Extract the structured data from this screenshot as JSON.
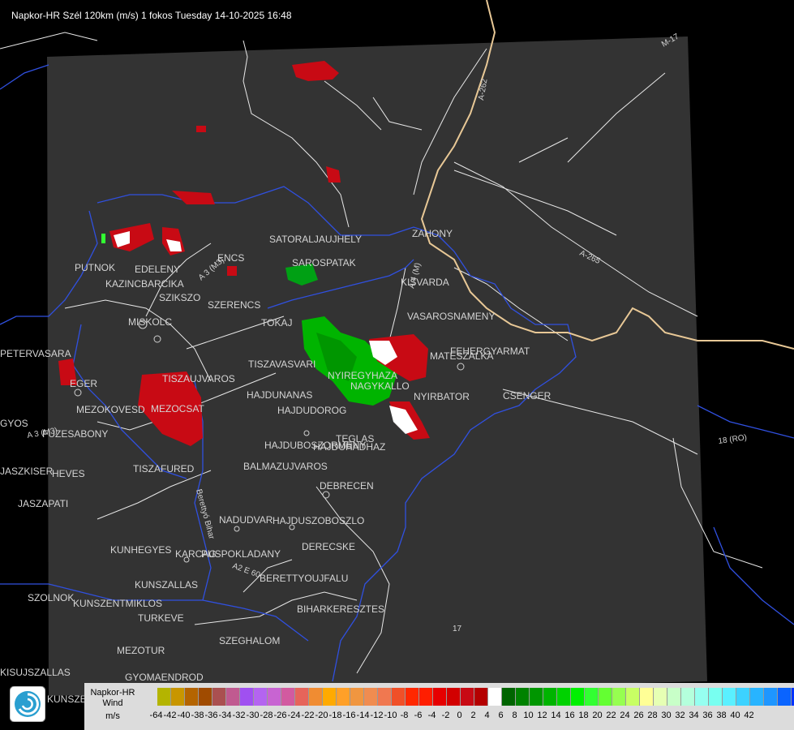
{
  "header": {
    "title": "Napkor-HR Szél 120km (m/s) 1 fokos Tuesday 14-10-2025 16:48"
  },
  "map": {
    "places": [
      "SATORALJAUJHELY",
      "ZAHONY",
      "SAROSPATAK",
      "KISVARDA",
      "PUTNOK",
      "EDELENY",
      "KAZINCBARCIKA",
      "SZIKSZO",
      "ENCS",
      "SZERENCS",
      "TOKAJ",
      "VASAROSNAMENY",
      "MISKOLC",
      "FEHERGYARMAT",
      "MATESZALKA",
      "TISZAVASVARI",
      "PETERVASARA",
      "EGER",
      "TISZAUJVAROS",
      "NYIREGYHAZA",
      "NAGYKALLO",
      "NYIRBATOR",
      "CSENGER",
      "HAJDUNANAS",
      "MEZOKOVESD",
      "MEZOCSAT",
      "HAJDUDOROG",
      "GYOS",
      "FUZESABONY",
      "TEGLAS",
      "HAJDUBOSZORMENY",
      "HAJDUHADHAZ",
      "HEVES",
      "TISZAFURED",
      "BALMAZUJVAROS",
      "DEBRECEN",
      "JASZAPATI",
      "NADUDVAR",
      "HAJDUSZOBOSZLO",
      "KUNHEGYES",
      "KARCAG",
      "PUSPOKLADANY",
      "DERECSKE",
      "KUNSZALLAS",
      "BERETTYOUJFALU",
      "SZOLNOK",
      "KUNSZENTMIKLOS",
      "TURKEVE",
      "BIHARKERESZTES",
      "SZEGHALOM",
      "MEZOTUR",
      "GYOMAENDROD",
      "JASZKISER",
      "KISUJSZALLAS",
      "KUNSZENTMARTON"
    ],
    "roads": [
      "M-17",
      "A-262",
      "A-265",
      "A 3 (M3)",
      "A 4 (M)",
      "18 (RO)",
      "A 3 (M3)",
      "17",
      "A2 E 60",
      "Berettyó Bihar"
    ]
  },
  "legend": {
    "title_line1": "Napkor-HR",
    "title_line2": "Wind",
    "unit": "m/s",
    "colors": [
      "#b4b400",
      "#c89600",
      "#b46400",
      "#a04b00",
      "#aa5050",
      "#c05a90",
      "#a050f0",
      "#b464f0",
      "#c864d2",
      "#d25aa0",
      "#e6645a",
      "#f08c32",
      "#ffaa00",
      "#ffa028",
      "#f09640",
      "#f08c50",
      "#f07850",
      "#f05028",
      "#ff2800",
      "#ff1e00",
      "#e60000",
      "#d20000",
      "#c80a14",
      "#b40000",
      "#ffffff",
      "#006400",
      "#008200",
      "#009600",
      "#00b400",
      "#00d200",
      "#00f000",
      "#32ff32",
      "#64ff32",
      "#96ff50",
      "#c8ff64",
      "#ffff96",
      "#e6ffb4",
      "#c8ffc8",
      "#b4ffdc",
      "#96fff0",
      "#78fff0",
      "#5af0ff",
      "#3cd2ff",
      "#28b4ff",
      "#1e96ff",
      "#0a64ff",
      "#0032ff",
      "#0000f0"
    ],
    "ticks": [
      "-64",
      "-42",
      "-40",
      "-38",
      "-36",
      "-34",
      "-32",
      "-30",
      "-28",
      "-26",
      "-24",
      "-22",
      "-20",
      "-18",
      "-16",
      "-14",
      "-12",
      "-10",
      "-8",
      "-6",
      "-4",
      "-2",
      "0",
      "2",
      "4",
      "6",
      "8",
      "10",
      "12",
      "14",
      "16",
      "18",
      "20",
      "22",
      "24",
      "26",
      "28",
      "30",
      "32",
      "34",
      "36",
      "38",
      "40",
      "42"
    ]
  }
}
